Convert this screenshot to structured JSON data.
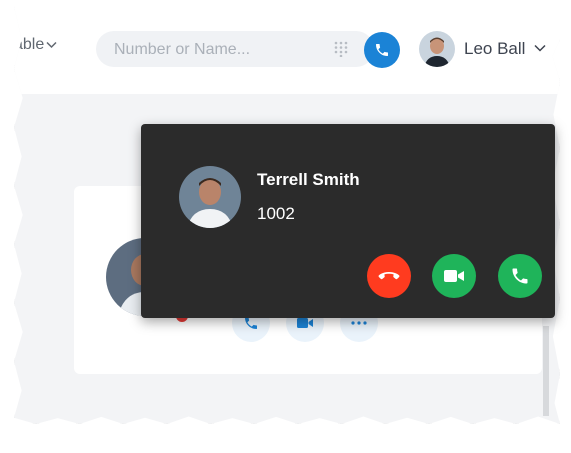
{
  "header": {
    "status_fragment": "able",
    "search": {
      "placeholder": "Number or Name...",
      "value": ""
    },
    "user": {
      "name": "Leo Ball"
    }
  },
  "incoming_call": {
    "caller_name": "Terrell Smith",
    "caller_number": "1002"
  },
  "colors": {
    "call_blue": "#1b83d6",
    "decline_red": "#ff3b1f",
    "accept_green": "#1fb45a",
    "popup_bg": "#2b2b2b",
    "presence_red": "#e53935"
  },
  "icons": {
    "status_chevron": "chevron-down-icon",
    "dialpad": "dialpad-icon",
    "call": "phone-icon",
    "user_chevron": "chevron-down-icon",
    "decline": "hangup-icon",
    "video": "video-icon",
    "accept": "phone-icon",
    "more": "more-icon"
  }
}
